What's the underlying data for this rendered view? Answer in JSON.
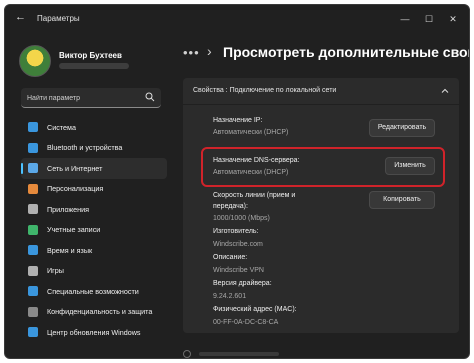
{
  "window": {
    "app_title": "Параметры",
    "controls": [
      "—",
      "☐",
      "✕"
    ]
  },
  "profile": {
    "name": "Виктор Бухтеев"
  },
  "search": {
    "placeholder": "Найти параметр"
  },
  "sidebar": {
    "items": [
      {
        "label": "Система",
        "icon": "monitor-icon",
        "color": "#3a96dd"
      },
      {
        "label": "Bluetooth и устройства",
        "icon": "bluetooth-icon",
        "color": "#3a96dd"
      },
      {
        "label": "Сеть и Интернет",
        "icon": "network-icon",
        "color": "#5ba8e8",
        "active": true
      },
      {
        "label": "Персонализация",
        "icon": "brush-icon",
        "color": "#e68a3c"
      },
      {
        "label": "Приложения",
        "icon": "apps-icon",
        "color": "#b0b0b0"
      },
      {
        "label": "Учетные записи",
        "icon": "person-icon",
        "color": "#3fb56b"
      },
      {
        "label": "Время и язык",
        "icon": "globe-icon",
        "color": "#3a96dd"
      },
      {
        "label": "Игры",
        "icon": "gamepad-icon",
        "color": "#b0b0b0"
      },
      {
        "label": "Специальные возможности",
        "icon": "accessibility-icon",
        "color": "#3a96dd"
      },
      {
        "label": "Конфиденциальность и защита",
        "icon": "shield-icon",
        "color": "#8a8a8a"
      },
      {
        "label": "Центр обновления Windows",
        "icon": "update-icon",
        "color": "#3a96dd"
      }
    ]
  },
  "breadcrumb": {
    "dots": "•••",
    "separator": "›",
    "page_title": "Просмотреть дополнительные свой"
  },
  "section": {
    "title": "Свойства : Подключение по локальной сети"
  },
  "properties": {
    "ip_label": "Назначение IP:",
    "ip_value": "Автоматически (DHCP)",
    "edit_button": "Редактировать",
    "dns_label": "Назначение DNS-сервера:",
    "dns_value": "Автоматически (DHCP)",
    "change_button": "Изменить",
    "speed_label_1": "Скорость линии (прием и",
    "speed_label_2": "передача):",
    "speed_value": "1000/1000 (Mbps)",
    "copy_button": "Копировать",
    "manufacturer_label": "Изготовитель:",
    "manufacturer_value": "Windscribe.com",
    "description_label": "Описание:",
    "description_value": "Windscribe VPN",
    "driver_label": "Версия драйвера:",
    "driver_value": "9.24.2.601",
    "mac_label": "Физический адрес (MAC):",
    "mac_value": "00-FF-0A-DC-C8-CA"
  },
  "colors": {
    "accent": "#4cc2ff",
    "highlight": "#d0232a",
    "background": "#202020",
    "card": "#2b2b2b"
  }
}
